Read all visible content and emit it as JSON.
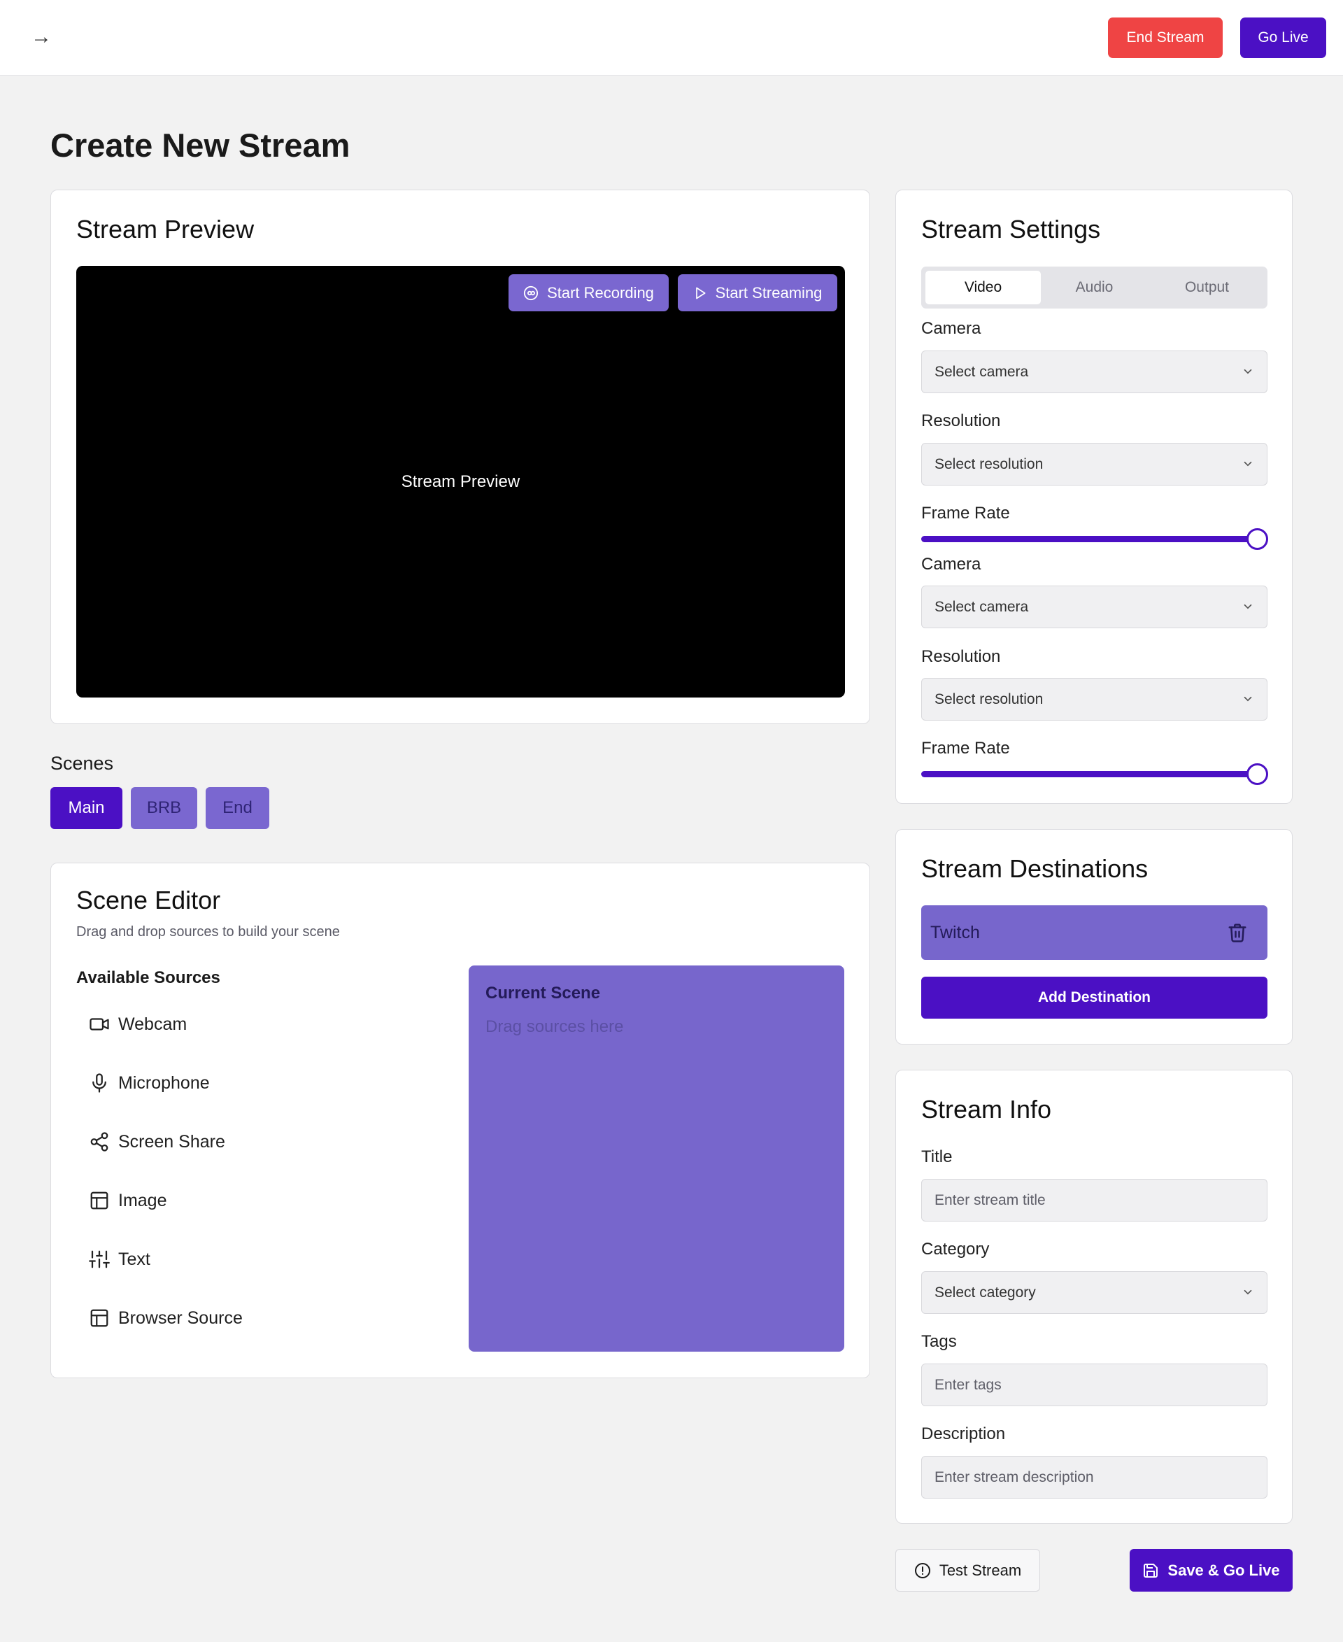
{
  "header": {
    "back_icon": "→",
    "end_stream_label": "End Stream",
    "go_live_label": "Go Live"
  },
  "page": {
    "title": "Create New Stream"
  },
  "preview": {
    "title": "Stream Preview",
    "placeholder": "Stream Preview",
    "start_recording_label": "Start Recording",
    "start_streaming_label": "Start Streaming"
  },
  "scenes": {
    "label": "Scenes",
    "items": [
      {
        "label": "Main",
        "active": true
      },
      {
        "label": "BRB",
        "active": false
      },
      {
        "label": "End",
        "active": false
      }
    ]
  },
  "editor": {
    "title": "Scene Editor",
    "subtitle": "Drag and drop sources to build your scene",
    "available_label": "Available Sources",
    "sources": [
      {
        "label": "Webcam",
        "icon": "video-camera-icon"
      },
      {
        "label": "Microphone",
        "icon": "microphone-icon"
      },
      {
        "label": "Screen Share",
        "icon": "share-icon"
      },
      {
        "label": "Image",
        "icon": "layout-icon"
      },
      {
        "label": "Text",
        "icon": "sliders-icon"
      },
      {
        "label": "Browser Source",
        "icon": "layout-icon"
      }
    ],
    "current_scene_title": "Current Scene",
    "current_scene_hint": "Drag sources here"
  },
  "settings": {
    "title": "Stream Settings",
    "tabs": [
      {
        "label": "Video",
        "active": true
      },
      {
        "label": "Audio",
        "active": false
      },
      {
        "label": "Output",
        "active": false
      }
    ],
    "camera_label": "Camera",
    "camera_placeholder": "Select camera",
    "resolution_label": "Resolution",
    "resolution_placeholder": "Select resolution",
    "frame_rate_label": "Frame Rate",
    "frame_rate_level": 1.0,
    "camera_label_2": "Camera",
    "camera_placeholder_2": "Select camera",
    "resolution_label_2": "Resolution",
    "resolution_placeholder_2": "Select resolution",
    "frame_rate_label_2": "Frame Rate",
    "frame_rate_level_2": 1.0
  },
  "destinations": {
    "title": "Stream Destinations",
    "items": [
      {
        "name": "Twitch"
      }
    ],
    "add_label": "Add Destination"
  },
  "info": {
    "title": "Stream Info",
    "title_label": "Title",
    "title_placeholder": "Enter stream title",
    "category_label": "Category",
    "category_placeholder": "Select category",
    "tags_label": "Tags",
    "tags_placeholder": "Enter tags",
    "description_label": "Description",
    "description_placeholder": "Enter stream description"
  },
  "actions": {
    "test_label": "Test Stream",
    "save_label": "Save & Go Live"
  },
  "colors": {
    "primary": "#4b10c4",
    "primary_light": "#7766cc",
    "danger": "#ef4444",
    "background": "#f2f2f2"
  }
}
